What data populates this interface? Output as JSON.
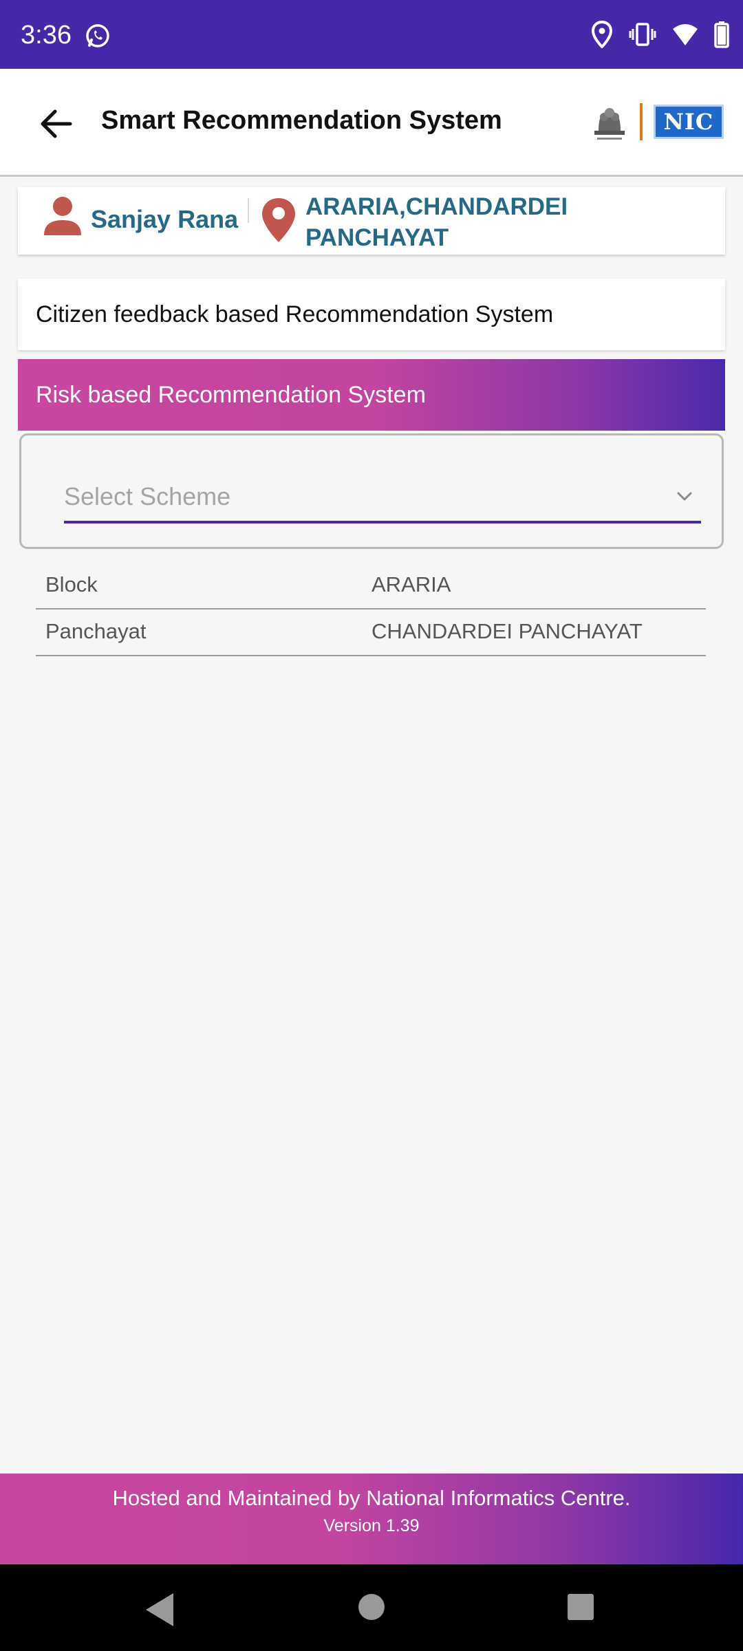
{
  "status_bar": {
    "time": "3:36",
    "icons": [
      "whatsapp-icon",
      "location-icon",
      "vibrate-icon",
      "wifi-icon",
      "battery-icon"
    ]
  },
  "app_bar": {
    "title": "Smart Recommendation System",
    "nic_logo_text": "NIC"
  },
  "user_card": {
    "name": "Sanjay Rana",
    "location": "ARARIA,CHANDARDEI PANCHAYAT"
  },
  "sections": {
    "citizen": "Citizen feedback based Recommendation System",
    "risk": "Risk based Recommendation System"
  },
  "scheme_select": {
    "placeholder": "Select Scheme"
  },
  "info_rows": [
    {
      "label": "Block",
      "value": "ARARIA"
    },
    {
      "label": "Panchayat",
      "value": "CHANDARDEI PANCHAYAT"
    }
  ],
  "footer": {
    "line1": "Hosted and Maintained by National Informatics Centre.",
    "line2": "Version 1.39"
  },
  "colors": {
    "primary": "#4527a8",
    "accent_pink": "#c8469f",
    "name_blue": "#256987",
    "pin_red": "#c0564d"
  }
}
